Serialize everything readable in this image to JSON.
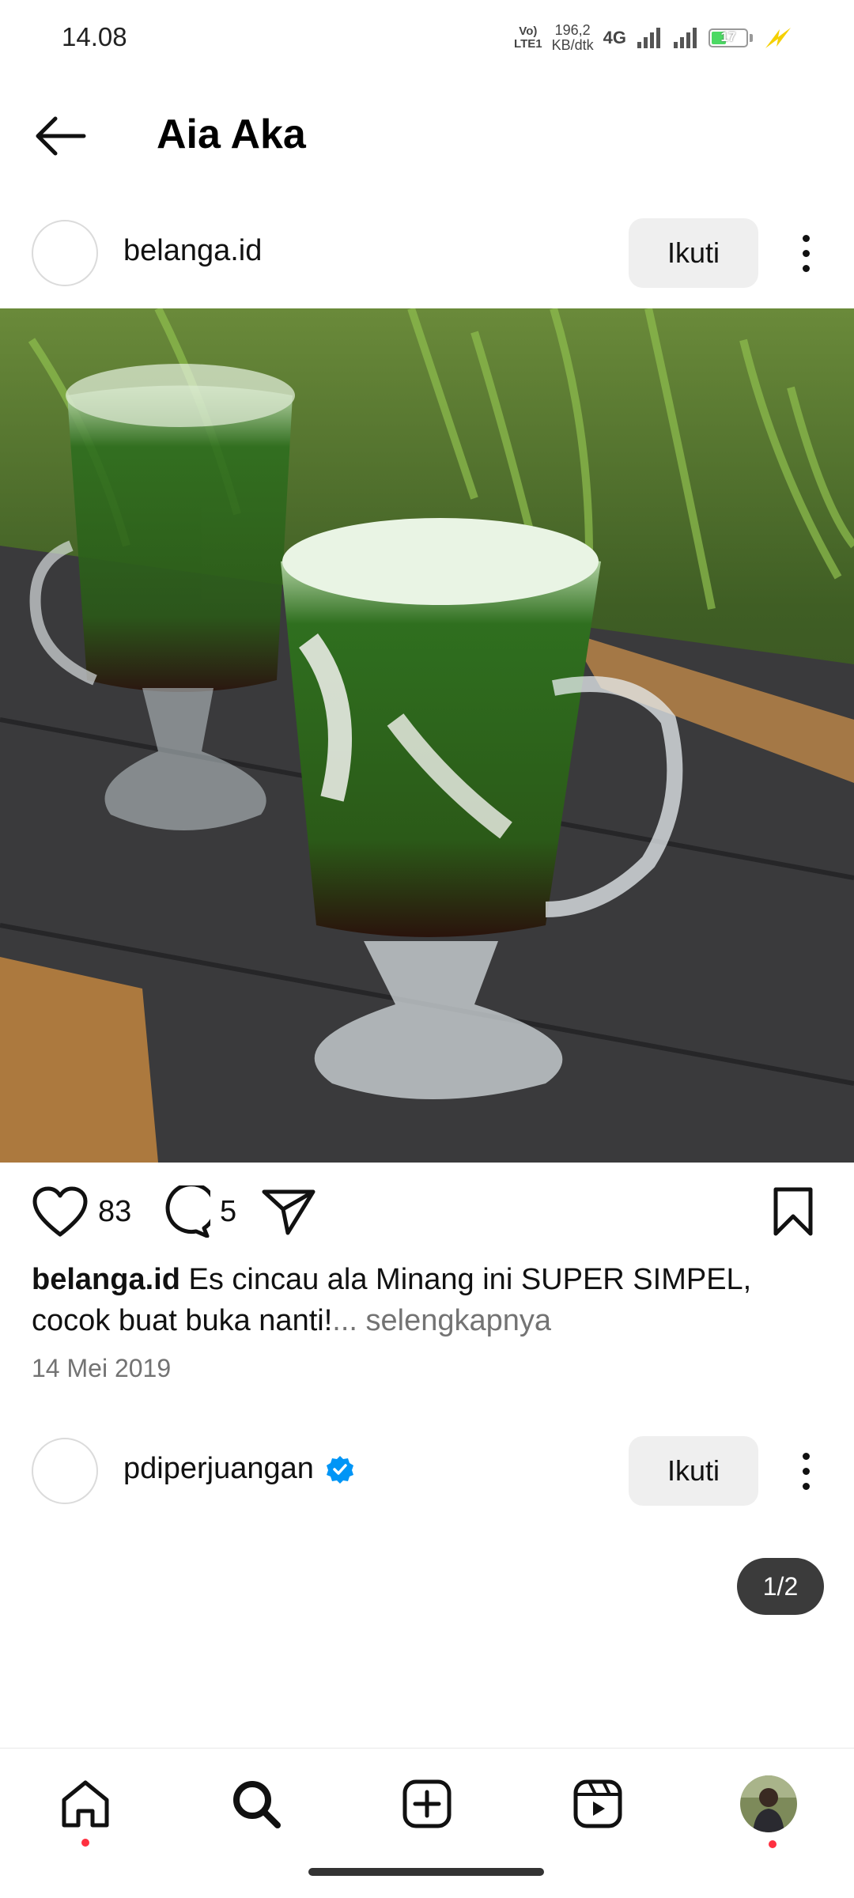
{
  "status_bar": {
    "time": "14.08",
    "volte": "Vo)",
    "lte": "LTE1",
    "speed_value": "196,2",
    "speed_unit": "KB/dtk",
    "network": "4G",
    "battery": "17"
  },
  "header": {
    "title": "Aia Aka",
    "back_icon": "arrow-left-icon"
  },
  "posts": [
    {
      "username": "belanga.id",
      "follow_label": "Ikuti",
      "likes": "83",
      "comments": "5",
      "caption_user": "belanga.id",
      "caption_text": " Es cincau ala Minang ini SUPER SIMPEL, cocok buat buka nanti!",
      "caption_more": "... selengkapnya",
      "date": "14 Mei 2019"
    },
    {
      "username": "pdiperjuangan",
      "verified": true,
      "follow_label": "Ikuti"
    }
  ],
  "page_indicator": "1/2",
  "bottom_nav": {
    "items": [
      "home-icon",
      "search-icon",
      "create-post-icon",
      "reels-icon",
      "profile-avatar"
    ]
  },
  "colors": {
    "accent_blue": "#0095f6",
    "notification_red": "#ff3040",
    "muted_text": "#737373"
  }
}
